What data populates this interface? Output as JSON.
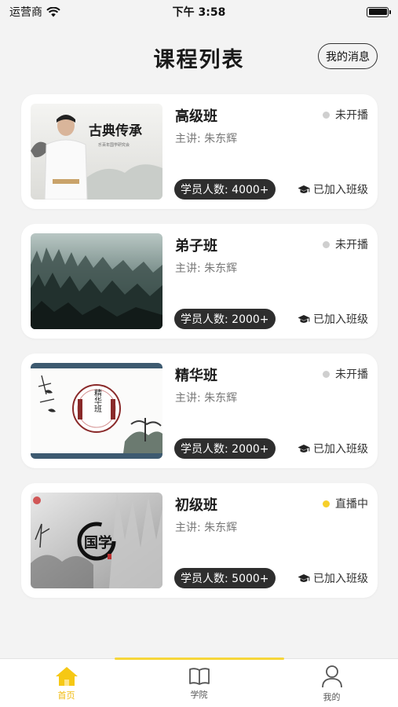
{
  "status_bar": {
    "carrier": "运营商",
    "time": "下午 3:58"
  },
  "header": {
    "title": "课程列表",
    "messages_label": "我的消息"
  },
  "courses": [
    {
      "name": "高级班",
      "teacher": "主讲: 朱东辉",
      "status": "未开播",
      "is_live": false,
      "student_count": "学员人数: 4000+",
      "joined": "已加入班级",
      "poster_text": "古典传承",
      "poster_sub": "乐百年国学研究会"
    },
    {
      "name": "弟子班",
      "teacher": "主讲: 朱东辉",
      "status": "未开播",
      "is_live": false,
      "student_count": "学员人数: 2000+",
      "joined": "已加入班级"
    },
    {
      "name": "精华班",
      "teacher": "主讲: 朱东辉",
      "status": "未开播",
      "is_live": false,
      "student_count": "学员人数: 2000+",
      "joined": "已加入班级",
      "poster_text": "精华班"
    },
    {
      "name": "初级班",
      "teacher": "主讲: 朱东辉",
      "status": "直播中",
      "is_live": true,
      "student_count": "学员人数: 5000+",
      "joined": "已加入班级",
      "poster_text": "国学"
    }
  ],
  "tabbar": {
    "items": [
      {
        "label": "首页",
        "icon": "home-icon",
        "active": true
      },
      {
        "label": "学院",
        "icon": "book-icon",
        "active": false
      },
      {
        "label": "我的",
        "icon": "user-icon",
        "active": false
      }
    ]
  },
  "colors": {
    "accent": "#f6d63a",
    "live_dot": "#f6cf2a",
    "idle_dot": "#cfcfcf",
    "badge_bg": "#2e2e2e"
  }
}
